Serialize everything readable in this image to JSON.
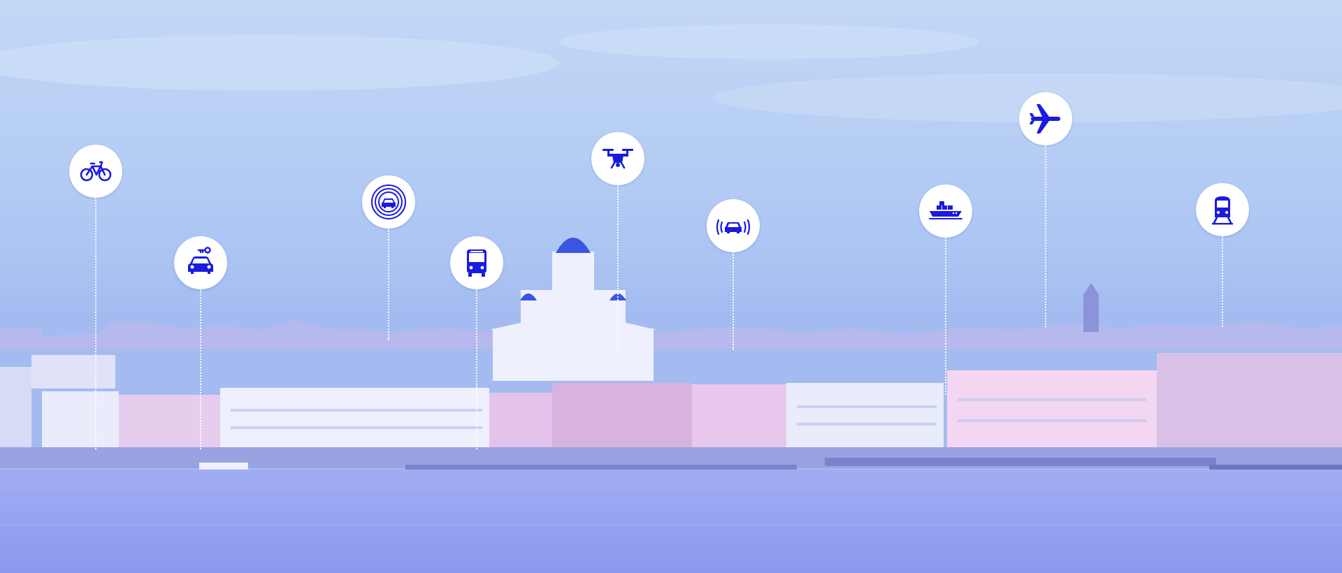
{
  "scene": {
    "city": "",
    "colors": {
      "sky_top": "#c3d8f6",
      "sky_bottom": "#a3bbf0",
      "water": "#8f9ff0",
      "buildings_light": "#e6e9fb",
      "buildings_pink": "#e7c6ea",
      "icon": "#1a1ae0",
      "marker_fill": "#ffffff"
    }
  },
  "markers": [
    {
      "name": "bicycle",
      "icon": "bicycle-icon"
    },
    {
      "name": "car-sharing",
      "icon": "car-key-icon"
    },
    {
      "name": "autonomous-car",
      "icon": "car-target-icon"
    },
    {
      "name": "bus",
      "icon": "bus-icon"
    },
    {
      "name": "drone",
      "icon": "drone-icon"
    },
    {
      "name": "connected-car",
      "icon": "car-signal-icon"
    },
    {
      "name": "cargo-ship",
      "icon": "ship-icon"
    },
    {
      "name": "airplane",
      "icon": "airplane-icon"
    },
    {
      "name": "train",
      "icon": "train-icon"
    }
  ]
}
